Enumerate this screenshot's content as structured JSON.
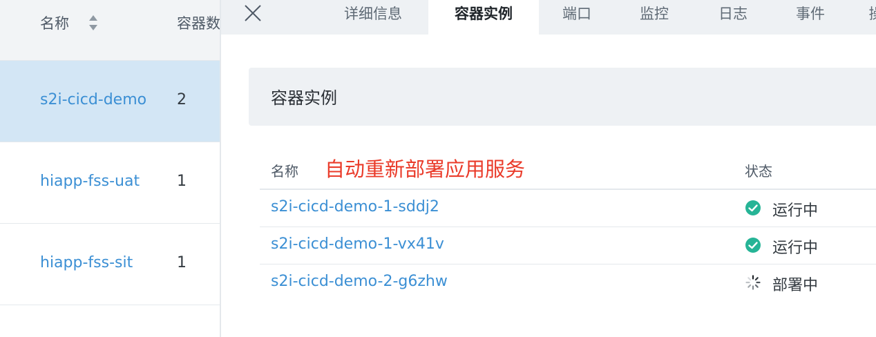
{
  "left_list": {
    "header": {
      "name_label": "名称",
      "count_label": "容器数"
    },
    "rows": [
      {
        "name": "s2i-cicd-demo",
        "count": "2"
      },
      {
        "name": "hiapp-fss-uat",
        "count": "1"
      },
      {
        "name": "hiapp-fss-sit",
        "count": "1"
      }
    ]
  },
  "detail": {
    "tabs": [
      {
        "label": "详细信息"
      },
      {
        "label": "容器实例"
      },
      {
        "label": "端口"
      },
      {
        "label": "监控"
      },
      {
        "label": "日志"
      },
      {
        "label": "事件"
      },
      {
        "label": "操"
      }
    ],
    "active_tab": "容器实例",
    "section_title": "容器实例",
    "table": {
      "name_header": "名称",
      "status_header": "状态",
      "annotation": "自动重新部署应用服务",
      "rows": [
        {
          "name": "s2i-cicd-demo-1-sddj2",
          "status": "运行中",
          "status_icon": "check-circle-icon"
        },
        {
          "name": "s2i-cicd-demo-1-vx41v",
          "status": "运行中",
          "status_icon": "check-circle-icon"
        },
        {
          "name": "s2i-cicd-demo-2-g6zhw",
          "status": "部署中",
          "status_icon": "spinner-icon"
        }
      ]
    }
  },
  "colors": {
    "link": "#3b8fd4",
    "selected_row": "#d3e6f5",
    "running": "#26b496",
    "annotation": "#ea3b2a"
  }
}
